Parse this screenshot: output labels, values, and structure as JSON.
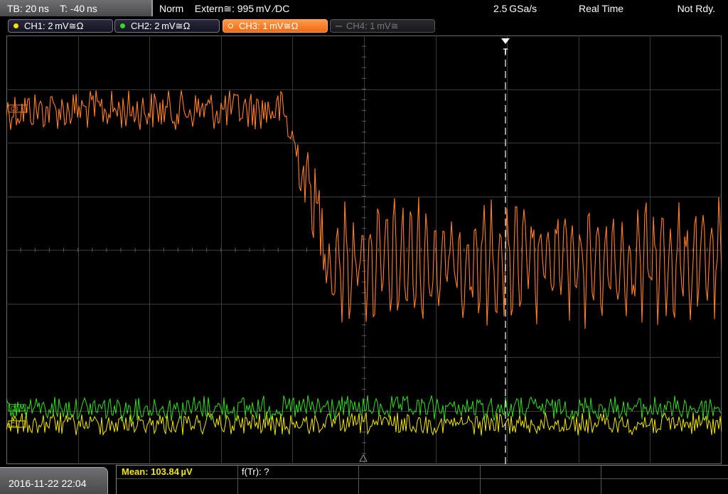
{
  "status_bar": {
    "timebase": "TB: 20 ns    T: -40 ns",
    "trigger": "Norm    Extern≅: 995 mV ∕DC",
    "sample_rate": "2.5 GSa/s",
    "mode": "Real Time",
    "state": "Not Rdy."
  },
  "channels": [
    {
      "label": "CH1: 2 mV≅Ω",
      "color": "#f2e600",
      "active": false
    },
    {
      "label": "CH2: 2 mV≅Ω",
      "color": "#33dd22",
      "active": false
    },
    {
      "label": "CH3: 1 mV≅Ω",
      "color": "#ff7f27",
      "active": true
    },
    {
      "label": "CH4: 1 mV≅",
      "color": "#777777",
      "active": false
    }
  ],
  "markers": {
    "ch3": "C3",
    "ch2": "C2",
    "ch1": "C1",
    "trigger": "T"
  },
  "bottom_bar": {
    "datetime": "2016-11-22 22:04",
    "mean": "Mean: 103.84 µV",
    "f_tr": "f(Tr): ?"
  },
  "colors": {
    "grid": "#3a3a3a",
    "grid_center": "#5a5a5a",
    "ch1": "#f2e600",
    "ch2": "#33dd22",
    "ch3": "#ff7f27",
    "trigger_line": "#ffffff"
  }
}
